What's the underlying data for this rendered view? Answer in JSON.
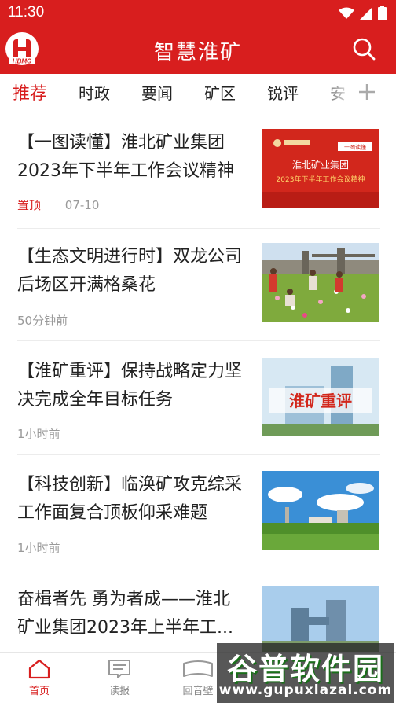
{
  "status_bar": {
    "time": "11:30"
  },
  "app": {
    "title": "智慧淮矿",
    "logo_text": "HBMG"
  },
  "tabs": [
    "推荐",
    "时政",
    "要闻",
    "矿区",
    "锐评",
    "安"
  ],
  "news": [
    {
      "title": "【一图读懂】淮北矿业集团2023年下半年工作会议精神",
      "pinned": "置顶",
      "time": "07-10",
      "thumb": {
        "tag": "一图读懂",
        "line1": "淮北矿业集团",
        "line2": "2023年下半年工作会议精神"
      }
    },
    {
      "title": "【生态文明进行时】双龙公司后场区开满格桑花",
      "pinned": "",
      "time": "50分钟前"
    },
    {
      "title": "【淮矿重评】保持战略定力坚决完成全年目标任务",
      "pinned": "",
      "time": "1小时前",
      "thumb": {
        "text": "淮矿重评"
      }
    },
    {
      "title": "【科技创新】临涣矿攻克综采工作面复合顶板仰采难题",
      "pinned": "",
      "time": "1小时前"
    },
    {
      "title": "奋楫者先 勇为者成——淮北矿业集团2023年上半年工...",
      "pinned": "",
      "time": ""
    }
  ],
  "bottom_nav": [
    "首页",
    "读报",
    "回音壁"
  ],
  "watermark": {
    "top": "谷普软件园",
    "bottom": "www.gupuxlazal.com"
  },
  "colors": {
    "brand": "#d81e1e",
    "text": "#222222",
    "muted": "#9a9a9a"
  }
}
